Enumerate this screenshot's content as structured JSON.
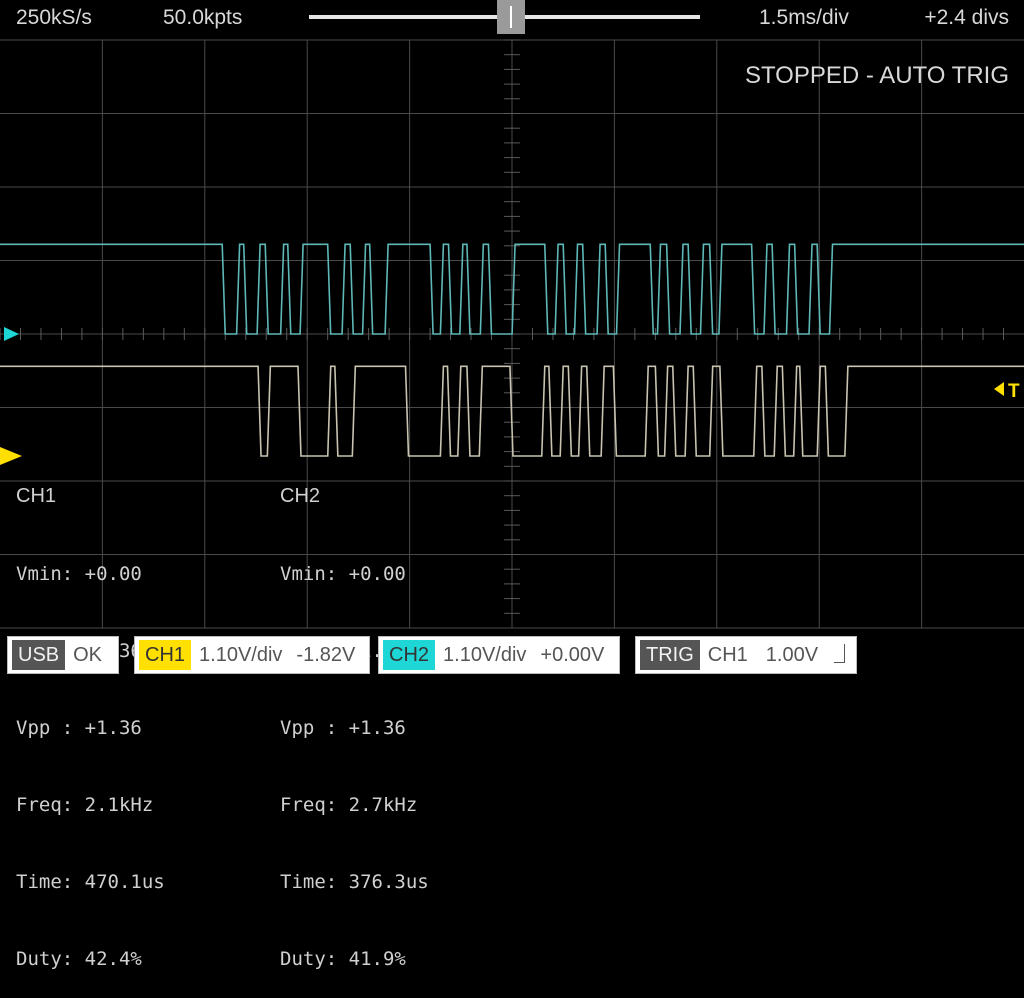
{
  "top_bar": {
    "sample_rate": "250kS/s",
    "points": "50.0kpts",
    "time_per_div": "1.5ms/div",
    "horizontal_offset": "+2.4 divs",
    "position_slider_fraction": 0.5
  },
  "status": "STOPPED - AUTO TRIG",
  "markers": {
    "ch1_ground_color": "#ffe000",
    "ch2_ground_color": "#1ed6d6",
    "trigger_label": "T",
    "trigger_color": "#ffe000"
  },
  "measurements": {
    "ch1": {
      "title": "CH1",
      "rows": [
        "Vmin: +0.00",
        "Vmax: +1.36",
        "Vpp : +1.36",
        "Freq: 2.1kHz",
        "Time: 470.1us",
        "Duty: 42.4%"
      ]
    },
    "ch2": {
      "title": "CH2",
      "rows": [
        "Vmin: +0.00",
        "Vmax: +1.36",
        "Vpp : +1.36",
        "Freq: 2.7kHz",
        "Time: 376.3us",
        "Duty: 41.9%"
      ]
    }
  },
  "bottom_bar": {
    "usb": {
      "tag": "USB",
      "value": "OK"
    },
    "ch1": {
      "tag": "CH1",
      "scale": "1.10V/div",
      "offset": "-1.82V",
      "color": "#ffe000"
    },
    "ch2": {
      "tag": "CH2",
      "scale": "1.10V/div",
      "offset": "+0.00V",
      "color": "#1ed6d6"
    },
    "trig": {
      "tag": "TRIG",
      "source": "CH1",
      "level": "1.00V",
      "edge": "rising"
    }
  },
  "waveforms": {
    "grid": {
      "hdivs": 10,
      "vdivs": 8
    },
    "ch1_trace": {
      "color": "#5fb8b8",
      "high_div": 1.22,
      "low_div": 0.0,
      "high_segments_div": [
        [
          0,
          2.17
        ],
        [
          2.34,
          2.38
        ],
        [
          2.54,
          2.59
        ],
        [
          2.77,
          2.81
        ],
        [
          2.96,
          3.2
        ],
        [
          3.37,
          3.42
        ],
        [
          3.57,
          3.61
        ],
        [
          3.79,
          4.2
        ],
        [
          4.33,
          4.38
        ],
        [
          4.52,
          4.56
        ],
        [
          4.72,
          4.77
        ],
        [
          5.03,
          5.32
        ],
        [
          5.45,
          5.5
        ],
        [
          5.64,
          5.69
        ],
        [
          5.86,
          5.91
        ],
        [
          6.05,
          6.35
        ],
        [
          6.45,
          6.51
        ],
        [
          6.67,
          6.72
        ],
        [
          6.87,
          6.93
        ],
        [
          7.05,
          7.34
        ],
        [
          7.49,
          7.54
        ],
        [
          7.71,
          7.76
        ],
        [
          7.93,
          7.98
        ],
        [
          8.13,
          10
        ]
      ]
    },
    "ch2_trace": {
      "color": "#c8c4b0",
      "high_div": 1.22,
      "low_div": 0.0,
      "high_segments_div": [
        [
          0,
          2.52
        ],
        [
          2.64,
          2.91
        ],
        [
          3.23,
          3.27
        ],
        [
          3.47,
          3.96
        ],
        [
          4.33,
          4.37
        ],
        [
          4.5,
          4.56
        ],
        [
          4.71,
          4.98
        ],
        [
          5.32,
          5.36
        ],
        [
          5.5,
          5.55
        ],
        [
          5.68,
          5.73
        ],
        [
          5.9,
          5.99
        ],
        [
          6.33,
          6.4
        ],
        [
          6.52,
          6.57
        ],
        [
          6.72,
          6.77
        ],
        [
          6.96,
          7.03
        ],
        [
          7.39,
          7.44
        ],
        [
          7.59,
          7.64
        ],
        [
          7.78,
          7.81
        ],
        [
          8.01,
          8.06
        ],
        [
          8.28,
          10
        ]
      ]
    }
  }
}
